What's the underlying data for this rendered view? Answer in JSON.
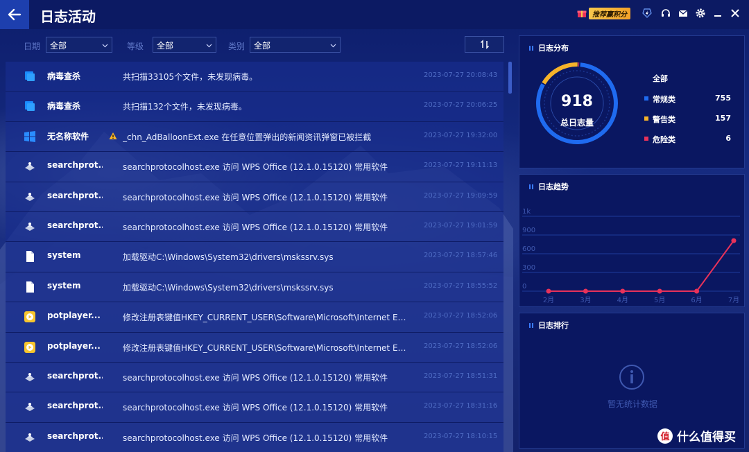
{
  "header": {
    "title": "日志活动",
    "promo_label": "推荐赢积分"
  },
  "filters": [
    {
      "label": "日期",
      "value": "全部"
    },
    {
      "label": "等级",
      "value": "全部"
    },
    {
      "label": "类别",
      "value": "全部"
    }
  ],
  "logs": [
    {
      "icon": "antivirus-scan-icon",
      "name": "病毒查杀",
      "warn": false,
      "message": "共扫描33105个文件，未发现病毒。",
      "time": "2023-07-27 20:08:43"
    },
    {
      "icon": "antivirus-scan-icon",
      "name": "病毒查杀",
      "warn": false,
      "message": "共扫描132个文件，未发现病毒。",
      "time": "2023-07-27 20:06:25"
    },
    {
      "icon": "windows-app-icon",
      "name": "无名称软件",
      "warn": true,
      "message": "_chn_AdBalloonExt.exe 在任意位置弹出的新闻资讯弹窗已被拦截",
      "time": "2023-07-27 19:32:00"
    },
    {
      "icon": "network-process-icon",
      "name": "searchprot...",
      "warn": false,
      "message": "searchprotocolhost.exe 访问 WPS Office (12.1.0.15120) 常用软件",
      "time": "2023-07-27 19:11:13"
    },
    {
      "icon": "network-process-icon",
      "name": "searchprot...",
      "warn": false,
      "message": "searchprotocolhost.exe 访问 WPS Office (12.1.0.15120) 常用软件",
      "time": "2023-07-27 19:09:59"
    },
    {
      "icon": "network-process-icon",
      "name": "searchprot...",
      "warn": false,
      "message": "searchprotocolhost.exe 访问 WPS Office (12.1.0.15120) 常用软件",
      "time": "2023-07-27 19:01:59"
    },
    {
      "icon": "file-icon",
      "name": "system",
      "warn": false,
      "message": "加载驱动C:\\Windows\\System32\\drivers\\mskssrv.sys",
      "time": "2023-07-27 18:57:46"
    },
    {
      "icon": "file-icon",
      "name": "system",
      "warn": false,
      "message": "加载驱动C:\\Windows\\System32\\drivers\\mskssrv.sys",
      "time": "2023-07-27 18:55:52"
    },
    {
      "icon": "potplayer-icon",
      "name": "potplayer...",
      "warn": false,
      "message": "修改注册表键值HKEY_CURRENT_USER\\Software\\Microsoft\\Internet Expl...",
      "time": "2023-07-27 18:52:06"
    },
    {
      "icon": "potplayer-icon",
      "name": "potplayer...",
      "warn": false,
      "message": "修改注册表键值HKEY_CURRENT_USER\\Software\\Microsoft\\Internet Expl...",
      "time": "2023-07-27 18:52:06"
    },
    {
      "icon": "network-process-icon",
      "name": "searchprot...",
      "warn": false,
      "message": "searchprotocolhost.exe 访问 WPS Office (12.1.0.15120) 常用软件",
      "time": "2023-07-27 18:51:31"
    },
    {
      "icon": "network-process-icon",
      "name": "searchprot...",
      "warn": false,
      "message": "searchprotocolhost.exe 访问 WPS Office (12.1.0.15120) 常用软件",
      "time": "2023-07-27 18:31:16"
    },
    {
      "icon": "network-process-icon",
      "name": "searchprot...",
      "warn": false,
      "message": "searchprotocolhost.exe 访问 WPS Office (12.1.0.15120) 常用软件",
      "time": "2023-07-27 18:10:15"
    }
  ],
  "distribution": {
    "title": "日志分布",
    "total": "918",
    "total_label": "总日志量",
    "all_label": "全部",
    "items": [
      {
        "label": "常规类",
        "value": "755",
        "color": "#1f6bf0"
      },
      {
        "label": "警告类",
        "value": "157",
        "color": "#f6b32a"
      },
      {
        "label": "危险类",
        "value": "6",
        "color": "#e8325a"
      }
    ]
  },
  "trend": {
    "title": "日志趋势"
  },
  "ranking": {
    "title": "日志排行",
    "empty_text": "暂无统计数据"
  },
  "chart_data": {
    "type": "line",
    "categories": [
      "2月",
      "3月",
      "4月",
      "5月",
      "6月",
      "7月"
    ],
    "values": [
      0,
      0,
      0,
      0,
      0,
      810
    ],
    "y_tick_labels": [
      "0",
      "300",
      "600",
      "900",
      "1k"
    ],
    "y_ticks": [
      0,
      300,
      600,
      900,
      1200
    ],
    "ylim": [
      0,
      1200
    ],
    "color": "#e8325a",
    "grid": true
  },
  "watermark": {
    "badge": "值",
    "text": "什么值得买"
  }
}
